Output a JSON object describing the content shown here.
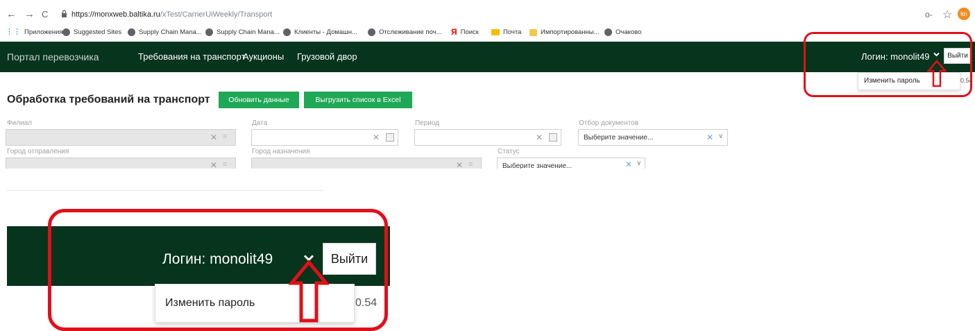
{
  "browser": {
    "back": "←",
    "forward": "→",
    "reload": "C",
    "url_host": "https://monxweb.baltika.ru",
    "url_path": "/xTest/CarrierUiWeekly/Transport",
    "profile_initials": "kn",
    "bookmarks": [
      {
        "label": "Приложения",
        "icon": "apps-grid-icon"
      },
      {
        "label": "Suggested Sites",
        "icon": "globe-icon"
      },
      {
        "label": "Supply Chain Mana...",
        "icon": "globe-icon"
      },
      {
        "label": "Supply Chain Mana...",
        "icon": "globe-icon"
      },
      {
        "label": "Клиенты - Домашн...",
        "icon": "globe-icon"
      },
      {
        "label": "Отслеживание поч...",
        "icon": "globe-icon"
      },
      {
        "label": "Поиск",
        "icon": "yandex-icon"
      },
      {
        "label": "Почта",
        "icon": "mail-icon"
      },
      {
        "label": "Импортированны...",
        "icon": "folder-icon"
      },
      {
        "label": "Очаково",
        "icon": "globe-icon"
      }
    ]
  },
  "header": {
    "portal_title": "Портал перевозчика",
    "nav": [
      "Требования на транспорт",
      "Аукционы",
      "Грузовой двор"
    ],
    "login_label": "Логин: monolit49",
    "logout_label": "Выйти",
    "dropdown_item": "Изменить пароль",
    "version_fragment": "0.54"
  },
  "main": {
    "title": "Обработка требований на транспорт",
    "refresh_button": "Обновить данные",
    "export_button": "Выгрузить список в Excel",
    "filters": {
      "branch_label": "Филиал",
      "date_label": "Дата",
      "period_label": "Период",
      "doc_filter_label": "Отбор документов",
      "doc_filter_placeholder": "Выберите значение...",
      "origin_label": "Город отправления",
      "destination_label": "Город назначения",
      "status_label": "Статус",
      "status_placeholder": "Выберите значение..."
    }
  },
  "colors": {
    "header_bg": "#06341c",
    "button_green": "#1fa856",
    "highlight_red": "#e0101a"
  }
}
